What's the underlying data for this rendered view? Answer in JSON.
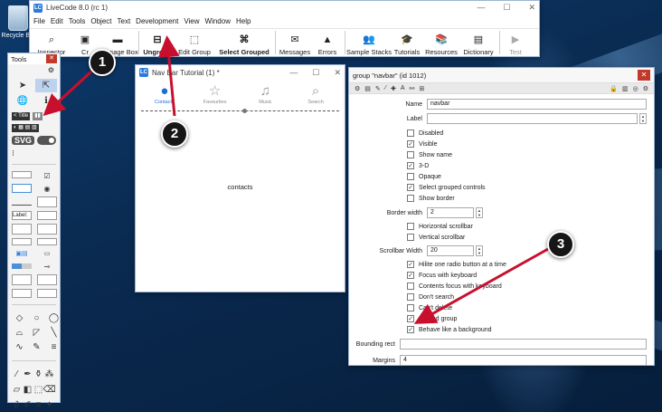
{
  "desktop": {
    "recycle_bin_label": "Recycle Bin"
  },
  "main_window": {
    "title": "LiveCode 8.0 (rc 1)",
    "menu": [
      "File",
      "Edit",
      "Tools",
      "Object",
      "Text",
      "Development",
      "View",
      "Window",
      "Help"
    ],
    "toolbar": [
      {
        "label": "Inspector",
        "icon": "magnifier-icon"
      },
      {
        "label": "Cr",
        "icon": "code-editor-icon"
      },
      {
        "label": "Message Box",
        "icon": "terminal-icon"
      },
      {
        "label": "Ungroup",
        "icon": "ungroup-icon"
      },
      {
        "label": "Edit Group",
        "icon": "edit-group-icon"
      },
      {
        "label": "Select Grouped",
        "icon": "select-grouped-icon"
      },
      {
        "label": "Messages",
        "icon": "messages-icon"
      },
      {
        "label": "Errors",
        "icon": "warning-icon"
      },
      {
        "label": "Sample Stacks",
        "icon": "people-icon"
      },
      {
        "label": "Tutorials",
        "icon": "graduation-cap-icon"
      },
      {
        "label": "Resources",
        "icon": "books-icon"
      },
      {
        "label": "Dictionary",
        "icon": "dictionary-icon"
      },
      {
        "label": "Test",
        "icon": "play-icon"
      }
    ]
  },
  "tools_palette": {
    "title": "Tools",
    "title_label": "< Title",
    "svg_label": "SVG",
    "field_label": "Label:"
  },
  "navbar_window": {
    "title": "Nav Bar Tutorial (1) *",
    "tabs": [
      {
        "label": "Contacts",
        "icon": "person-icon",
        "active": true
      },
      {
        "label": "Favourites",
        "icon": "star-icon",
        "active": false
      },
      {
        "label": "Music",
        "icon": "music-note-icon",
        "active": false
      },
      {
        "label": "Search",
        "icon": "search-icon",
        "active": false
      }
    ],
    "body_text": "contacts"
  },
  "inspector": {
    "title": "group \"navbar\" (id 1012)",
    "name_label": "Name",
    "name_value": "navbar",
    "label_label": "Label",
    "label_value": "",
    "checkboxes_1": [
      {
        "label": "Disabled",
        "checked": false
      },
      {
        "label": "Visible",
        "checked": true
      },
      {
        "label": "Show name",
        "checked": false
      },
      {
        "label": "3-D",
        "checked": true
      },
      {
        "label": "Opaque",
        "checked": false
      },
      {
        "label": "Select grouped controls",
        "checked": true
      },
      {
        "label": "Show border",
        "checked": false
      }
    ],
    "border_width_label": "Border width",
    "border_width_value": "2",
    "checkboxes_2": [
      {
        "label": "Horizontal scrollbar",
        "checked": false
      },
      {
        "label": "Vertical scrollbar",
        "checked": false
      }
    ],
    "scrollbar_width_label": "Scrollbar Width",
    "scrollbar_width_value": "20",
    "checkboxes_3": [
      {
        "label": "Hilite one radio button at a time",
        "checked": true
      },
      {
        "label": "Focus with keyboard",
        "checked": true
      },
      {
        "label": "Contents focus with keyboard",
        "checked": false
      },
      {
        "label": "Don't search",
        "checked": false
      },
      {
        "label": "Can't delete",
        "checked": false
      },
      {
        "label": "Shared group",
        "checked": true
      },
      {
        "label": "Behave like a background",
        "checked": true
      }
    ],
    "bounding_rect_label": "Bounding rect",
    "bounding_rect_value": "",
    "margins_label": "Margins",
    "margins_value": "4"
  },
  "callouts": [
    "1",
    "2",
    "3"
  ],
  "colors": {
    "accent": "#1a6fd1",
    "arrow": "#c8102e",
    "close": "#c0392b"
  }
}
